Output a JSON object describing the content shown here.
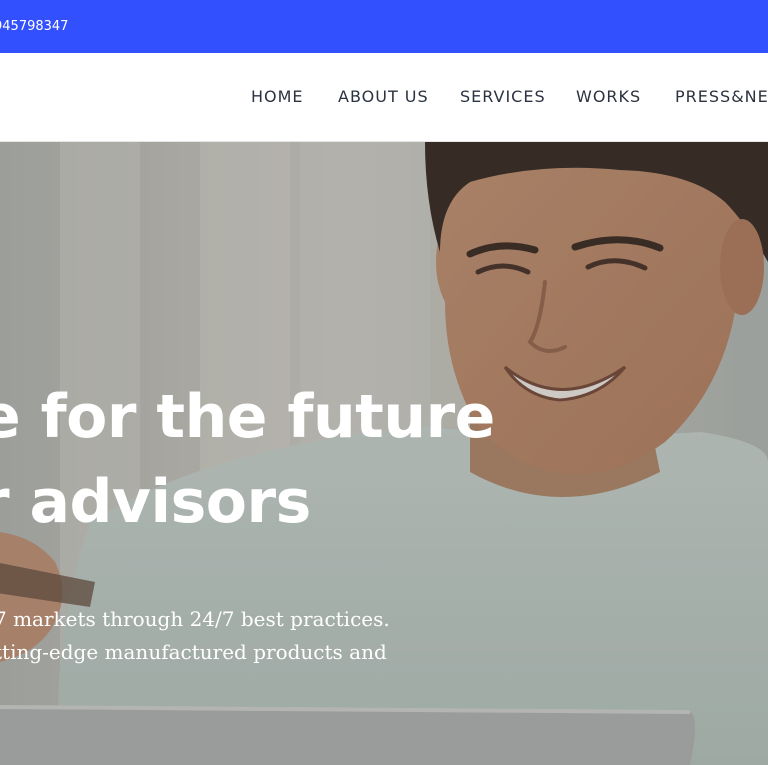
{
  "topbar": {
    "phone": "945798347",
    "bg_color": "#3350ff"
  },
  "nav": {
    "items": [
      {
        "label": "HOME"
      },
      {
        "label": "ABOUT US"
      },
      {
        "label": "SERVICES"
      },
      {
        "label": "WORKS"
      },
      {
        "label": "PRESS&NE"
      }
    ]
  },
  "hero": {
    "headline": [
      "e for the future",
      "r advisors"
    ],
    "subtext": [
      "7 markets through 24/7 best practices.",
      "tting-edge manufactured products and"
    ]
  }
}
